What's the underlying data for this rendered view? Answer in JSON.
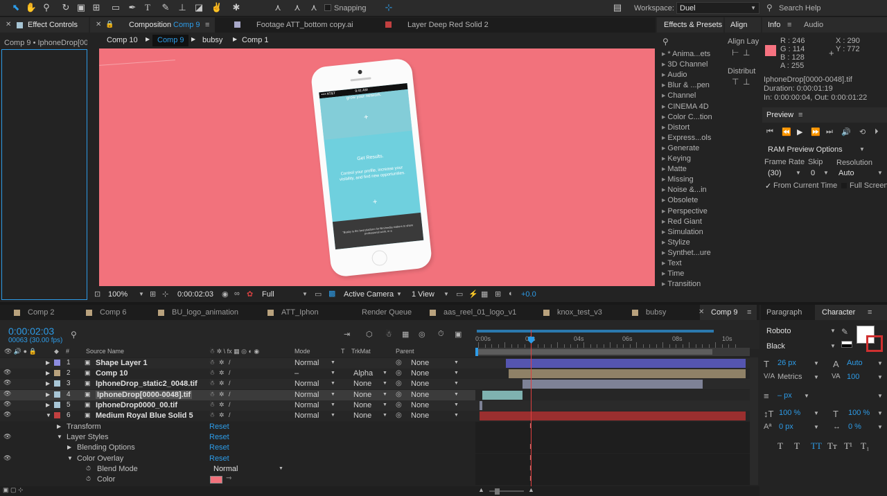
{
  "toolbar": {
    "snapping_label": "Snapping",
    "workspace_label": "Workspace:",
    "workspace_value": "Duel",
    "search_placeholder": "Search Help"
  },
  "left_panel": {
    "tab": "Effect Controls",
    "subtitle": "Comp 9 • IphoneDrop[00"
  },
  "comp_panel": {
    "tabs": [
      {
        "label": "Composition",
        "name": "Comp 9"
      },
      {
        "label": "Footage ATT_bottom copy.ai"
      },
      {
        "label": "Layer Deep Red Solid 2"
      }
    ],
    "breadcrumbs": [
      "Comp 10",
      "Comp 9",
      "bubsy",
      "Comp 1"
    ],
    "phone": {
      "carrier": "•••• AT&T",
      "time": "9:41 AM",
      "top_text": "grow your network.",
      "mid_title": "Get Results.",
      "mid_body": "Control your profile, increase your visibility, and find new opportunities.",
      "plus": "+",
      "footer_text": "\"Busby is the best platform for film/media makers to share professional work, in a"
    },
    "bottom_bar": {
      "zoom": "100%",
      "timecode": "0:00:02:03",
      "resolution": "Full",
      "camera": "Active Camera",
      "view": "1 View",
      "exposure": "+0.0"
    },
    "bg_color": "#f2727c"
  },
  "effects_presets": {
    "tab": "Effects & Presets",
    "search_placeholder": "",
    "items": [
      "* Anima...ets",
      "3D Channel",
      "Audio",
      "Blur & ...pen",
      "Channel",
      "CINEMA 4D",
      "Color C...tion",
      "Distort",
      "Express...ols",
      "Generate",
      "Keying",
      "Matte",
      "Missing",
      "Noise &...in",
      "Obsolete",
      "Perspective",
      "Red Giant",
      "Simulation",
      "Stylize",
      "Synthet...ure",
      "Text",
      "Time",
      "Transition"
    ]
  },
  "align_panel": {
    "tab": "Align",
    "align_to": "Align Lay",
    "distribute": "Distribut"
  },
  "info_panel": {
    "tab": "Info",
    "audio_tab": "Audio",
    "r": "R : 246",
    "g": "G : 114",
    "b": "B : 128",
    "a": "A : 255",
    "x": "X : 290",
    "y": "Y : 772",
    "swatch": "#f67280",
    "file": "IphoneDrop[0000-0048].tif",
    "duration": "Duration: 0:00:01:19",
    "inout": "In: 0:00:00:04, Out: 0:00:01:22"
  },
  "preview_panel": {
    "tab": "Preview",
    "ram": "RAM Preview Options",
    "frame_rate_label": "Frame Rate",
    "skip_label": "Skip",
    "resolution_label": "Resolution",
    "frame_rate": "(30)",
    "skip": "0",
    "resolution": "Auto",
    "from_current": "From Current Time",
    "full_screen": "Full Screen"
  },
  "timeline": {
    "tabs": [
      {
        "label": "Comp 2",
        "color": "#b9a27d"
      },
      {
        "label": "Comp 6",
        "color": "#b9a27d"
      },
      {
        "label": "BU_logo_animation",
        "color": "#b9a27d"
      },
      {
        "label": "ATT_Iphon",
        "color": "#b9a27d"
      },
      {
        "label": "Render Queue",
        "color": ""
      },
      {
        "label": "aas_reel_01_logo_v1",
        "color": "#b9a27d"
      },
      {
        "label": "knox_test_v3",
        "color": "#b9a27d"
      },
      {
        "label": "bubsy",
        "color": "#b9a27d"
      },
      {
        "label": "Comp 9",
        "color": ""
      }
    ],
    "timecode": "0:00:02:03",
    "frames": "00063 (30.00 fps)",
    "headers": {
      "num": "#",
      "source": "Source Name",
      "mode": "Mode",
      "t": "T",
      "trkmat": "TrkMat",
      "parent": "Parent"
    },
    "ruler": [
      "0:00s",
      "02s",
      "04s",
      "06s",
      "08s",
      "10s"
    ],
    "layers": [
      {
        "num": "1",
        "name": "Shape Layer 1",
        "color": "#8c8ce0",
        "mode": "Normal",
        "trkmat": "",
        "parent": "None",
        "bar": "#5555b0"
      },
      {
        "num": "2",
        "name": "Comp 10",
        "color": "#b9a27d",
        "mode": "–",
        "trkmat": "Alpha",
        "parent": "None",
        "bar": "#8f8167"
      },
      {
        "num": "3",
        "name": "IphoneDrop_static2_0048.tif",
        "color": "#a7c5d5",
        "mode": "Normal",
        "trkmat": "None",
        "parent": "None",
        "bar": "#7e8296"
      },
      {
        "num": "4",
        "name": "IphoneDrop[0000-0048].tif",
        "color": "#a7c5d5",
        "mode": "Normal",
        "trkmat": "None",
        "parent": "None",
        "bar": "#7fb2b0"
      },
      {
        "num": "5",
        "name": "IphoneDrop0000_00.tif",
        "color": "#a7c5d5",
        "mode": "Normal",
        "trkmat": "None",
        "parent": "None",
        "bar": "#7e8296"
      },
      {
        "num": "6",
        "name": "Medium Royal Blue Solid 5",
        "color": "#c24040",
        "mode": "Normal",
        "trkmat": "None",
        "parent": "None",
        "bar": "#9a2f2f"
      }
    ],
    "props": [
      {
        "label": "Transform",
        "value": "Reset"
      },
      {
        "label": "Layer Styles",
        "value": "Reset"
      },
      {
        "label": "Blending Options",
        "value": "Reset"
      },
      {
        "label": "Color Overlay",
        "value": "Reset"
      },
      {
        "label": "Blend Mode",
        "value": "Normal"
      },
      {
        "label": "Color",
        "value": ""
      }
    ],
    "overlay_color": "#f2727c"
  },
  "character_panel": {
    "paragraph_tab": "Paragraph",
    "character_tab": "Character",
    "font": "Roboto",
    "style": "Black",
    "size": "26 px",
    "leading": "Auto",
    "kerning": "Metrics",
    "tracking": "100",
    "stroke": "– px",
    "vscale": "100 %",
    "hscale": "100 %",
    "baseline": "0 px",
    "tsume": "0 %",
    "glyphs": [
      "T",
      "T",
      "TT",
      "Tт",
      "T¹",
      "T₁"
    ]
  }
}
